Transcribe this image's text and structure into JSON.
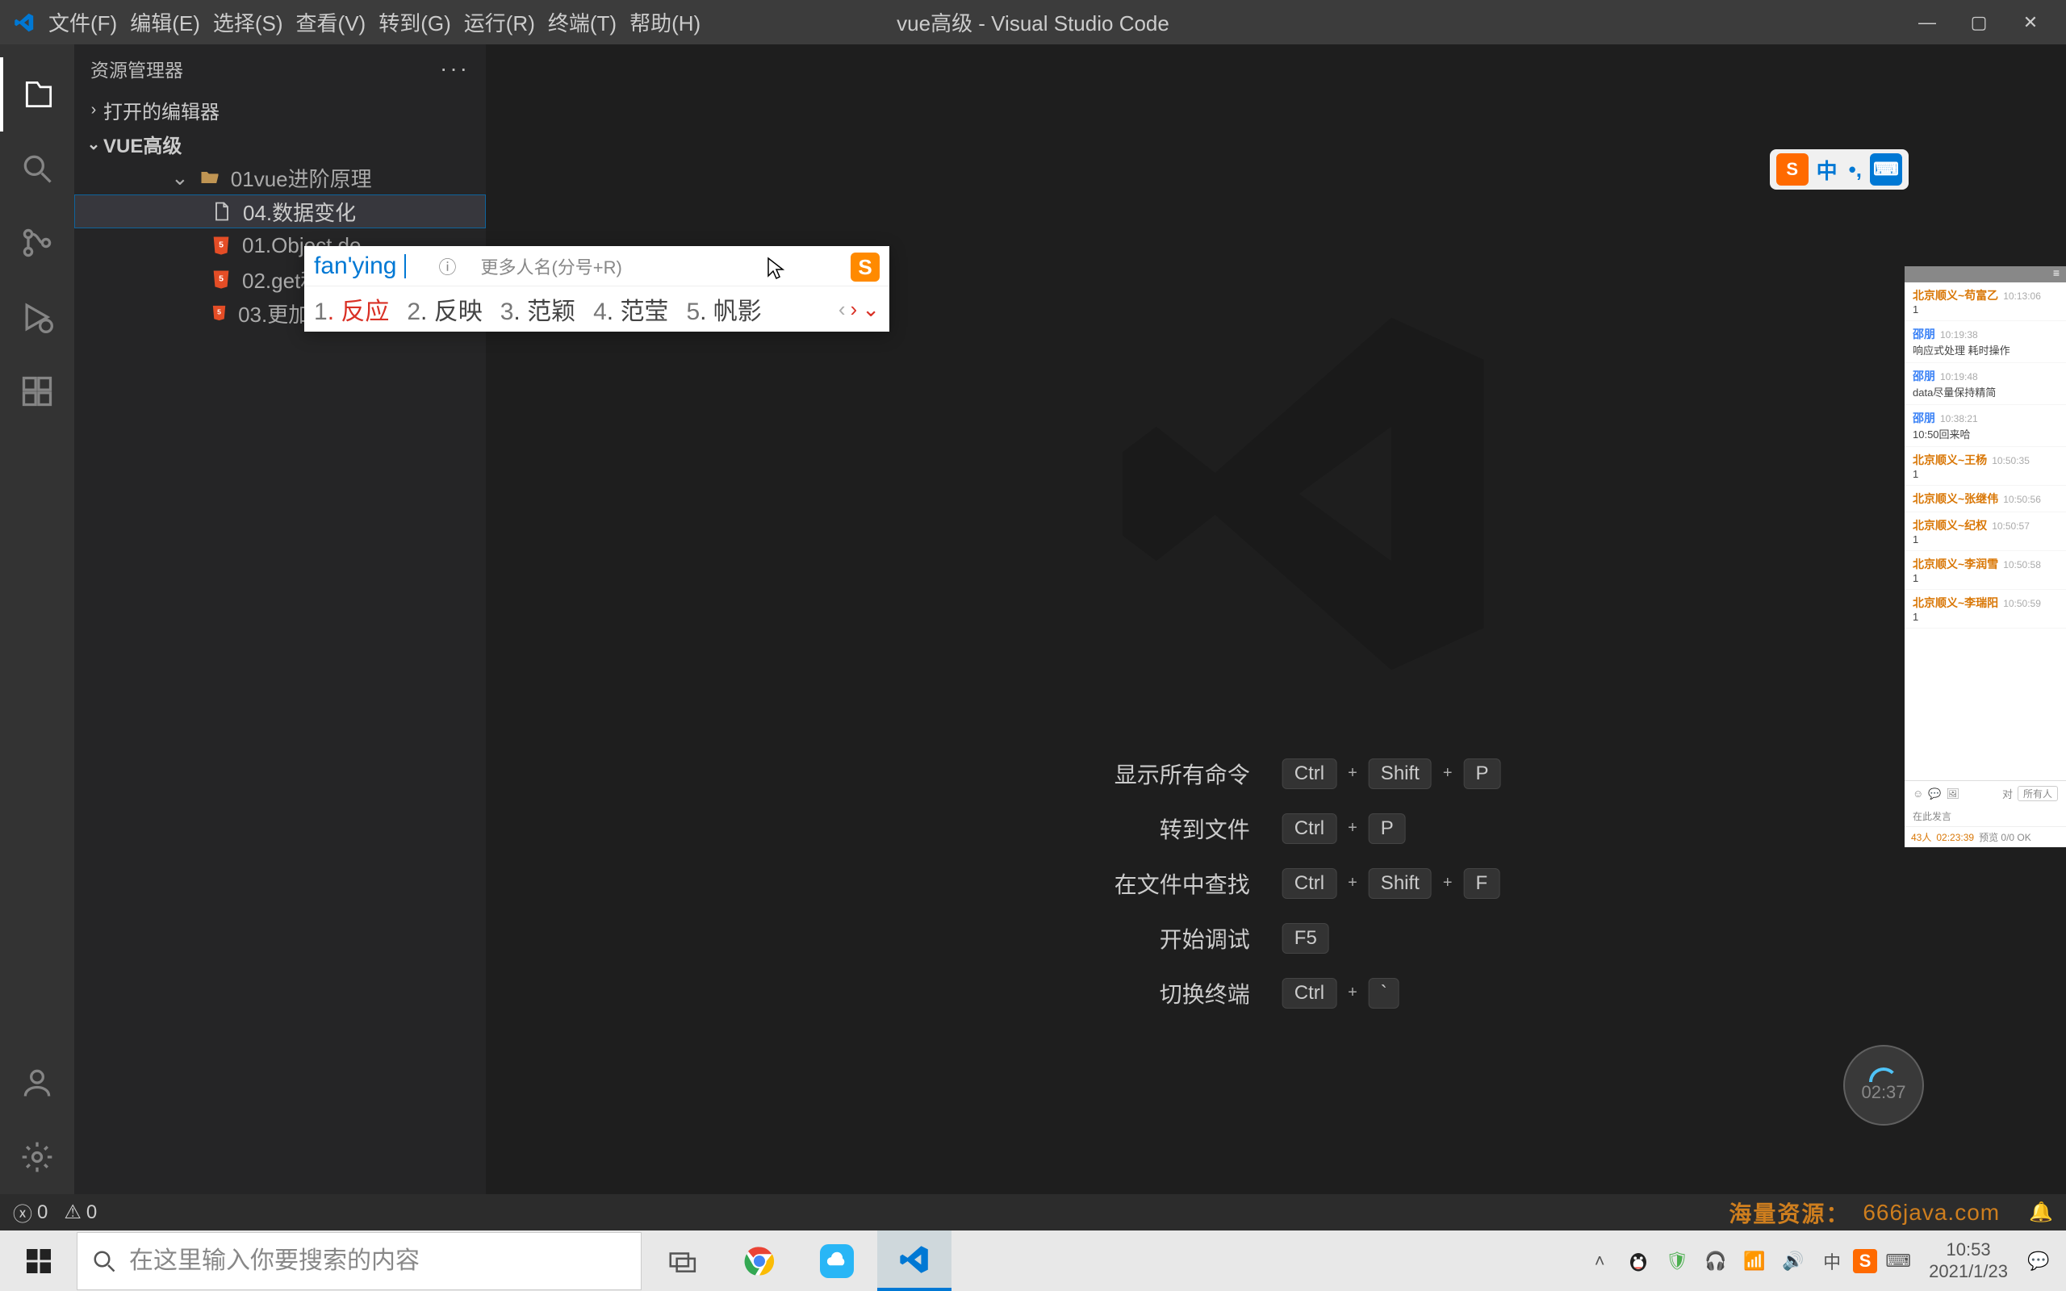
{
  "titlebar": {
    "menus": [
      "文件(F)",
      "编辑(E)",
      "选择(S)",
      "查看(V)",
      "转到(G)",
      "运行(R)",
      "终端(T)",
      "帮助(H)"
    ],
    "title": "vue高级 - Visual Studio Code"
  },
  "sidebar": {
    "header": "资源管理器",
    "sections": {
      "openEditors": "打开的编辑器",
      "project": "VUE高级"
    },
    "tree": {
      "folder": "01vue进阶原理",
      "editing": "04.数据变化",
      "files": [
        "01.Object.de...",
        "02.get和set...",
        "03.更加通用的动得方案实现.ht..."
      ]
    }
  },
  "shortcuts": [
    {
      "label": "显示所有命令",
      "keys": [
        "Ctrl",
        "+",
        "Shift",
        "+",
        "P"
      ]
    },
    {
      "label": "转到文件",
      "keys": [
        "Ctrl",
        "+",
        "P"
      ]
    },
    {
      "label": "在文件中查找",
      "keys": [
        "Ctrl",
        "+",
        "Shift",
        "+",
        "F"
      ]
    },
    {
      "label": "开始调试",
      "keys": [
        "F5"
      ]
    },
    {
      "label": "切换终端",
      "keys": [
        "Ctrl",
        "+",
        "`"
      ]
    }
  ],
  "ime": {
    "input": "fan'ying",
    "hint": "更多人名(分号+R)",
    "candidates": [
      {
        "n": "1",
        "t": "反应"
      },
      {
        "n": "2",
        "t": "反映"
      },
      {
        "n": "3",
        "t": "范颖"
      },
      {
        "n": "4",
        "t": "范莹"
      },
      {
        "n": "5",
        "t": "帆影"
      }
    ]
  },
  "sogou_ind": {
    "s": "S",
    "mid": "中",
    "punct": "•,",
    "kb": "⌨"
  },
  "chat": {
    "msgs": [
      {
        "name": "北京顺义~苟富乙",
        "cls": "orange",
        "time": "10:13:06",
        "text": "1"
      },
      {
        "name": "邵朋",
        "cls": "blue",
        "time": "10:19:38",
        "text": "响应式处理   耗时操作"
      },
      {
        "name": "邵朋",
        "cls": "blue",
        "time": "10:19:48",
        "text": "data尽量保持精简"
      },
      {
        "name": "邵朋",
        "cls": "blue",
        "time": "10:38:21",
        "text": "10:50回来哈"
      },
      {
        "name": "北京顺义~王杨",
        "cls": "orange",
        "time": "10:50:35",
        "text": "1"
      },
      {
        "name": "北京顺义~张继伟",
        "cls": "orange",
        "time": "10:50:56",
        "text": ""
      },
      {
        "name": "北京顺义~纪权",
        "cls": "orange",
        "time": "10:50:57",
        "text": "1"
      },
      {
        "name": "北京顺义~李润雪",
        "cls": "orange",
        "time": "10:50:58",
        "text": "1"
      },
      {
        "name": "北京顺义~李瑞阳",
        "cls": "orange",
        "time": "10:50:59",
        "text": "1"
      }
    ],
    "foot_to": "对",
    "foot_everyone": "所有人",
    "footnote": "在此发言",
    "bottom_count": "43人",
    "bottom_timer": "02:23:39",
    "bottom_status": "预览  0/0 OK"
  },
  "timer": "02:37",
  "statusbar": {
    "errors": "0",
    "warnings": "0",
    "watermark_text": "海量资源：",
    "watermark_url": "666java.com"
  },
  "taskbar": {
    "search_placeholder": "在这里输入你要搜索的内容",
    "clock_time": "10:53",
    "clock_date": "2021/1/23"
  }
}
